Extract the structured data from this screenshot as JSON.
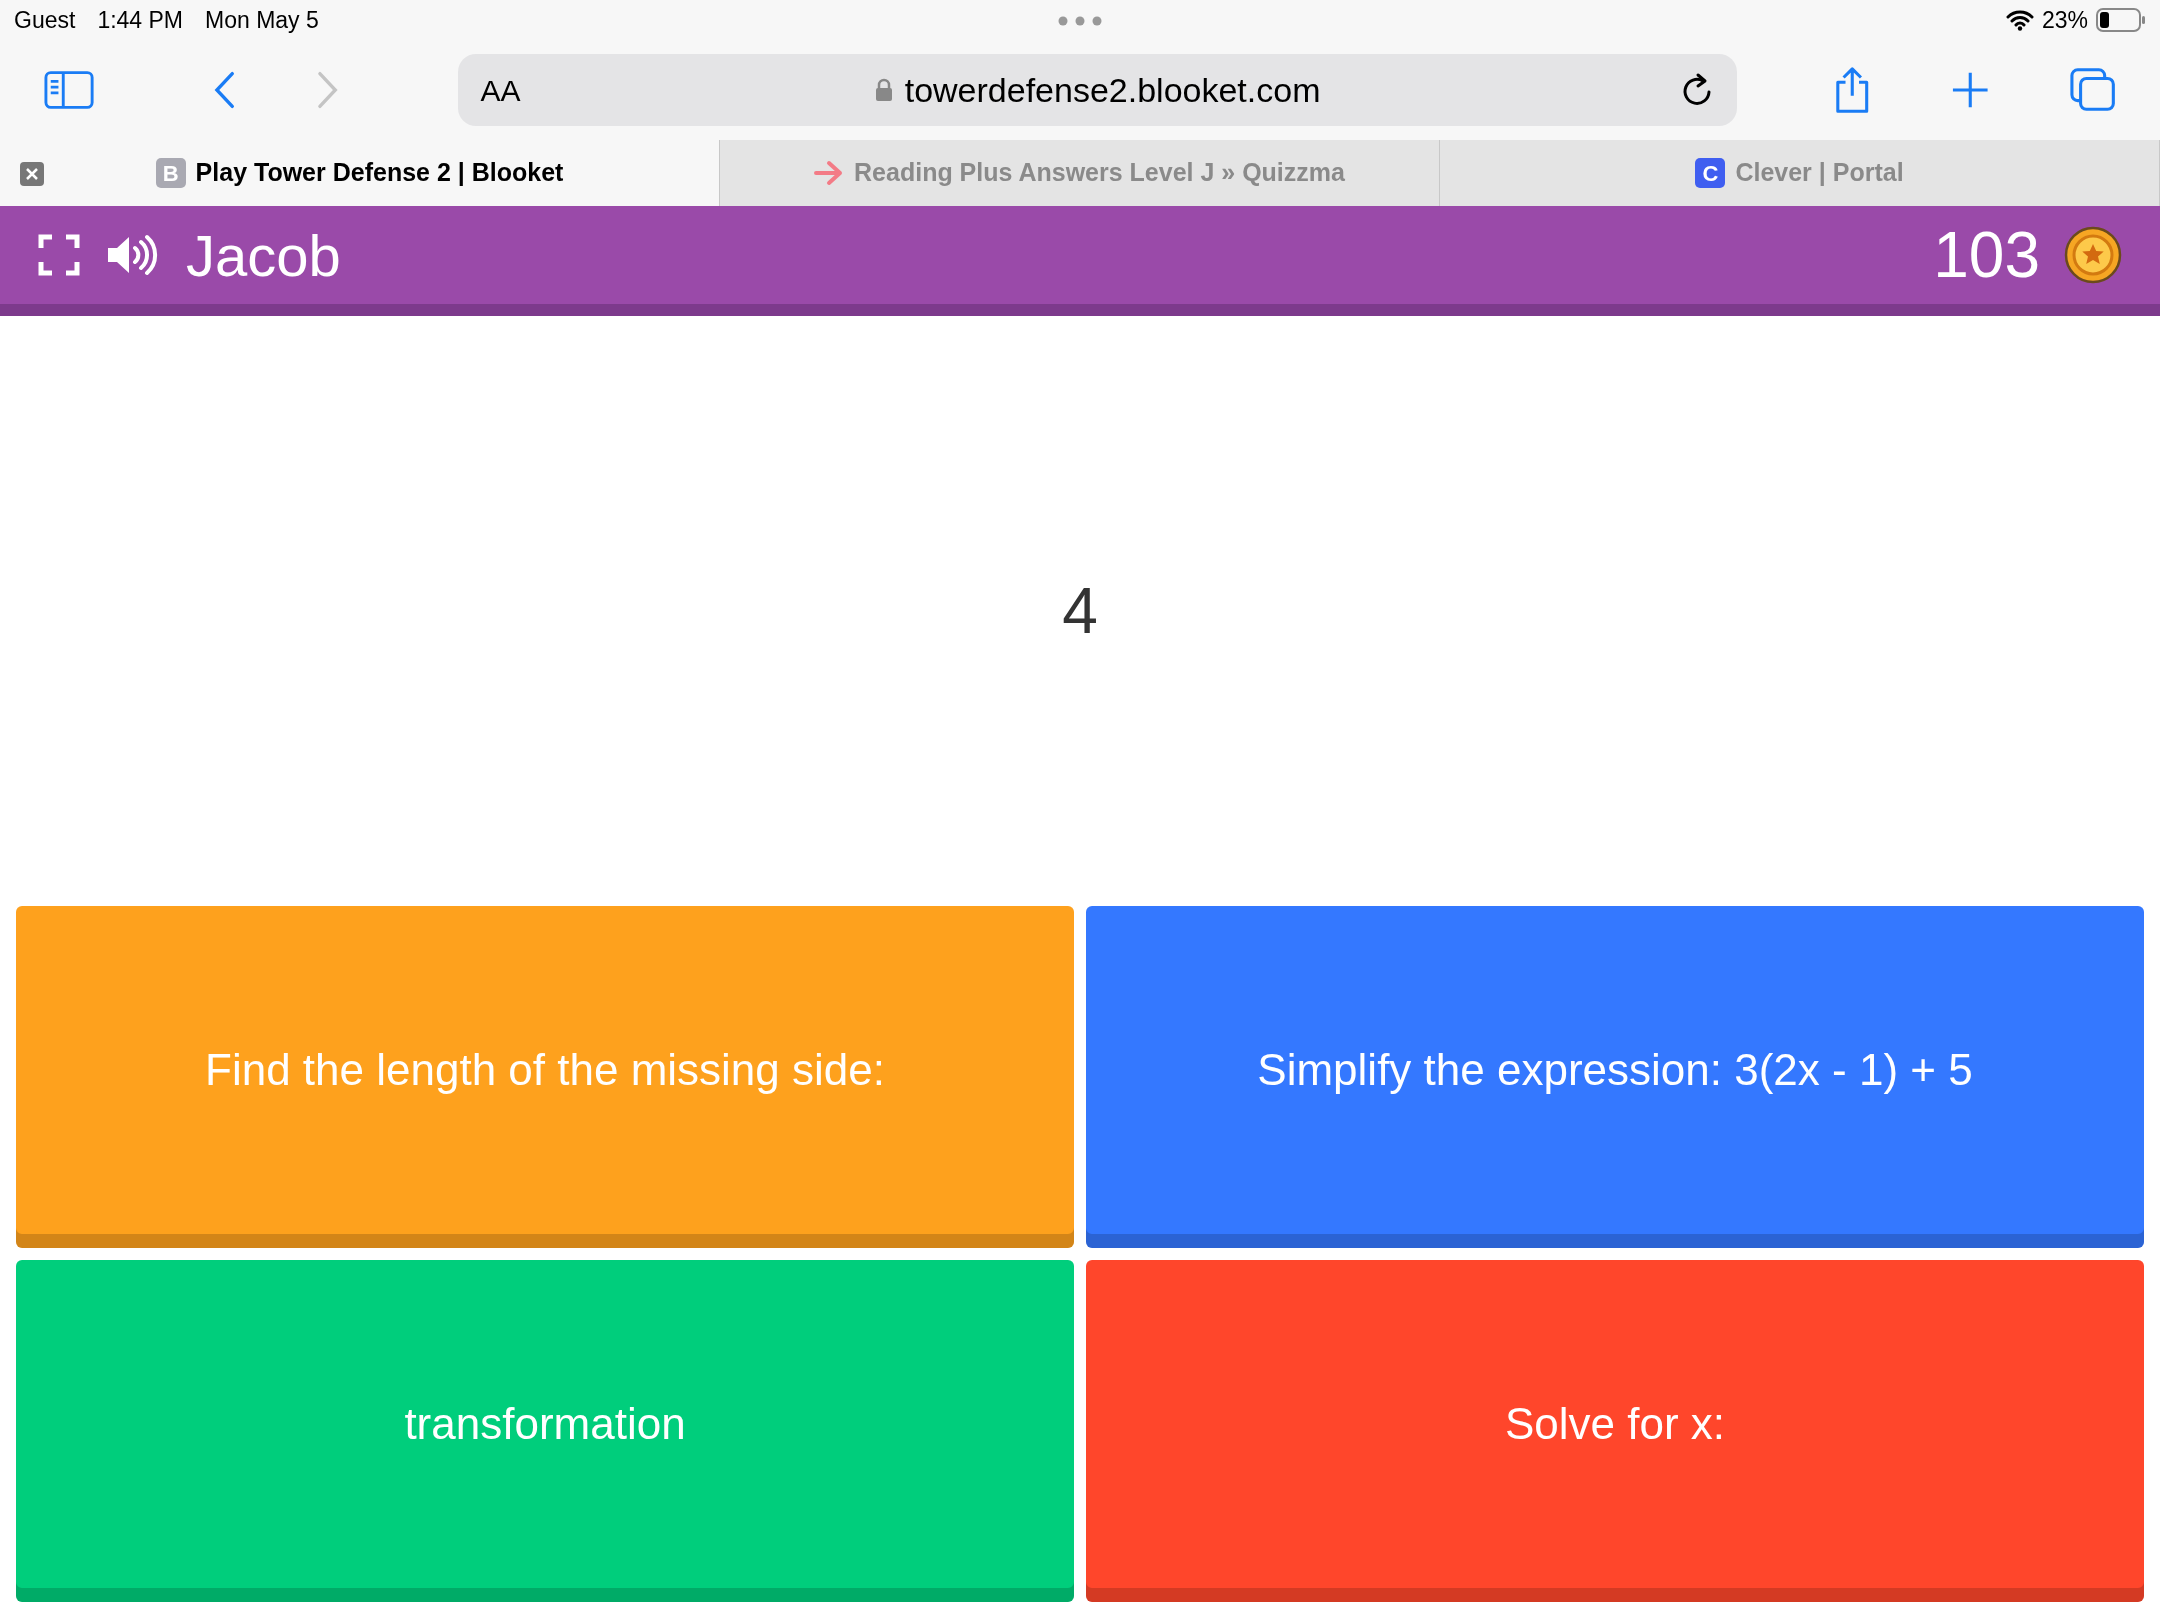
{
  "status_bar": {
    "user": "Guest",
    "time": "1:44 PM",
    "date": "Mon May 5",
    "battery": "23%"
  },
  "address_bar": {
    "text_size": "AA",
    "url": "towerdefense2.blooket.com"
  },
  "tabs": [
    {
      "favicon": "B",
      "title": "Play Tower Defense 2 | Blooket",
      "selected": true,
      "kind": "letter"
    },
    {
      "title": "Reading Plus Answers Level J » Quizzma",
      "selected": false,
      "kind": "arrow"
    },
    {
      "favicon": "C",
      "title": "Clever | Portal",
      "selected": false,
      "kind": "letter"
    }
  ],
  "game_header": {
    "player": "Jacob",
    "coins": "103"
  },
  "question": "4",
  "answers": [
    {
      "text": "Find the length of the missing side:",
      "color": "#fea11d"
    },
    {
      "text": "Simplify the expression: 3(2x - 1) + 5",
      "color": "#3478ff"
    },
    {
      "text": "transformation",
      "color": "#00ce7c"
    },
    {
      "text": "Solve for x:",
      "color": "#ff462b"
    }
  ]
}
